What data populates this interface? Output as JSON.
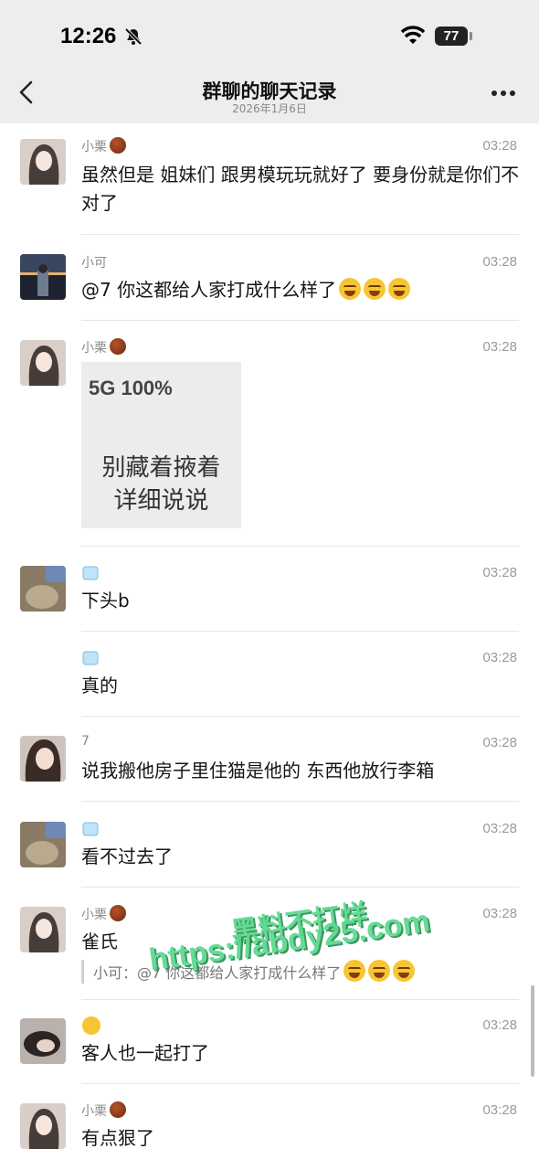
{
  "status_bar": {
    "time": "12:26",
    "battery": "77"
  },
  "nav": {
    "title": "群聊的聊天记录",
    "subtitle": "2026年1月6日"
  },
  "messages": [
    {
      "sender": "小栗",
      "time": "03:28",
      "text": "虽然但是 姐妹们 跟男模玩玩就好了 要身份就是你们不对了"
    },
    {
      "sender": "小可",
      "time": "03:28",
      "text": "@7 你这都给人家打成什么样了"
    },
    {
      "sender": "小栗",
      "time": "03:28",
      "sticker": {
        "status": "5G 100%",
        "line1": "别藏着掖着",
        "line2": "详细说说"
      }
    },
    {
      "sender": "",
      "time": "03:28",
      "text": "下头b"
    },
    {
      "sender": "",
      "time": "03:28",
      "text": "真的"
    },
    {
      "sender": "7",
      "time": "03:28",
      "text": "说我搬他房子里住猫是他的 东西他放行李箱"
    },
    {
      "sender": "",
      "time": "03:28",
      "text": "看不过去了"
    },
    {
      "sender": "小栗",
      "time": "03:28",
      "text": "雀氏",
      "quote": "小可：@7 你这都给人家打成什么样了"
    },
    {
      "sender": "",
      "time": "03:28",
      "text": "客人也一起打了"
    },
    {
      "sender": "小栗",
      "time": "03:28",
      "text": "有点狠了"
    }
  ],
  "watermark": {
    "line1": "黑料不打烊",
    "line2": "https://abdy25.com"
  },
  "icons": {
    "back": "chevron-left-icon",
    "more": "more-icon",
    "mute": "bell-slash-icon",
    "wifi": "wifi-icon"
  },
  "colors": {
    "header_bg": "#ededed",
    "watermark": "#59d98c"
  }
}
